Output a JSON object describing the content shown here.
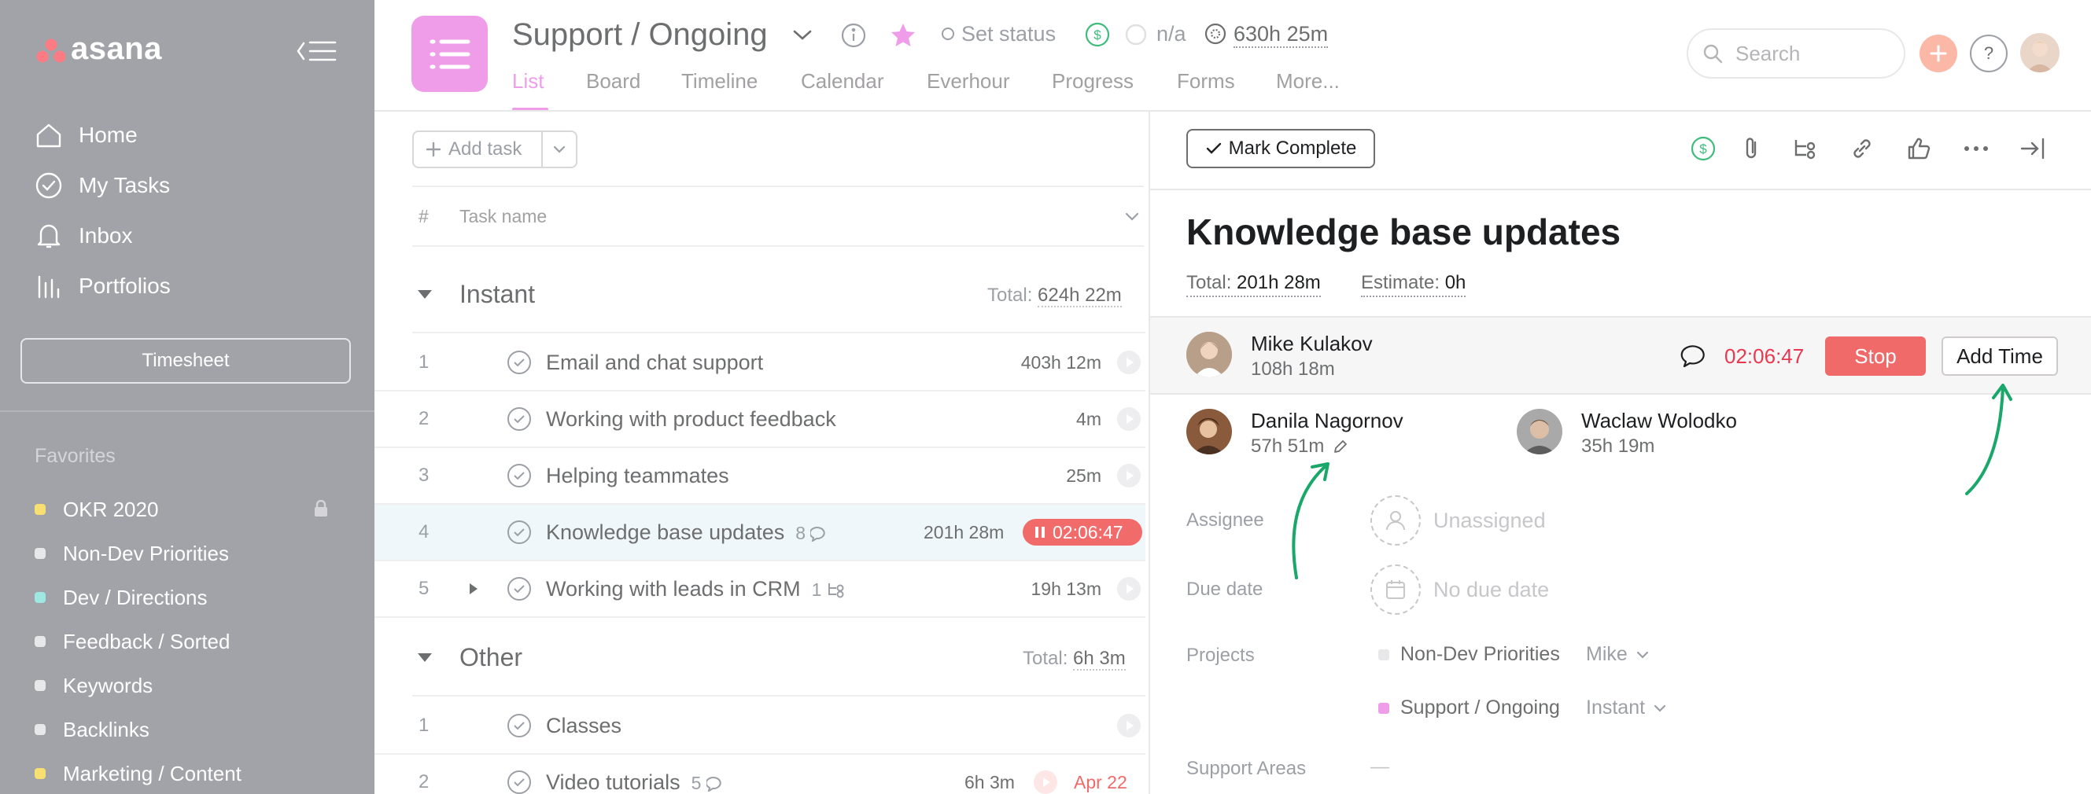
{
  "sidebar": {
    "logo": "asana",
    "nav": [
      {
        "label": "Home",
        "icon": "home-icon"
      },
      {
        "label": "My Tasks",
        "icon": "check-circle-icon"
      },
      {
        "label": "Inbox",
        "icon": "bell-icon"
      },
      {
        "label": "Portfolios",
        "icon": "bar-chart-icon"
      }
    ],
    "timesheet_label": "Timesheet",
    "favorites_heading": "Favorites",
    "favorites": [
      {
        "label": "OKR 2020",
        "color": "#f8df72"
      },
      {
        "label": "Non-Dev Priorities",
        "color": "#e8e8ea"
      },
      {
        "label": "Dev / Directions",
        "color": "#9ee7e3"
      },
      {
        "label": "Feedback / Sorted",
        "color": "#e8e8ea"
      },
      {
        "label": "Keywords",
        "color": "#e8e8ea"
      },
      {
        "label": "Backlinks",
        "color": "#e8e8ea"
      },
      {
        "label": "Marketing / Content",
        "color": "#f8df72"
      }
    ],
    "background": "#a2a2a9"
  },
  "header": {
    "project_title": "Support / Ongoing",
    "set_status": "Set status",
    "budget_na": "n/a",
    "time_total": "630h 25m",
    "tabs": [
      "List",
      "Board",
      "Timeline",
      "Calendar",
      "Everhour",
      "Progress",
      "Forms",
      "More..."
    ],
    "active_tab": "List",
    "search_placeholder": "Search",
    "accent": "#ef9de9"
  },
  "list": {
    "add_task_label": "Add task",
    "col_hash": "#",
    "col_task_name": "Task name",
    "sections": [
      {
        "title": "Instant",
        "total_label": "Total:",
        "total_value": "624h 22m",
        "tasks": [
          {
            "num": "1",
            "name": "Email and chat support",
            "meta": "",
            "time": "403h 12m"
          },
          {
            "num": "2",
            "name": "Working with product feedback",
            "meta": "",
            "time": "4m"
          },
          {
            "num": "3",
            "name": "Helping teammates",
            "meta": "",
            "time": "25m"
          },
          {
            "num": "4",
            "name": "Knowledge base updates",
            "meta": "8",
            "time": "201h 28m",
            "timer": "02:06:47"
          },
          {
            "num": "5",
            "name": "Working with leads in CRM",
            "meta": "1",
            "time": "19h 13m"
          }
        ]
      },
      {
        "title": "Other",
        "total_label": "Total:",
        "total_value": "6h 3m",
        "tasks": [
          {
            "num": "1",
            "name": "Classes",
            "meta": "",
            "time": ""
          },
          {
            "num": "2",
            "name": "Video tutorials",
            "meta": "5",
            "time": "6h 3m",
            "due": "Apr 22"
          }
        ]
      }
    ]
  },
  "detail": {
    "mark_complete": "Mark Complete",
    "title": "Knowledge base updates",
    "total_label": "Total:",
    "total_value": "201h 28m",
    "estimate_label": "Estimate:",
    "estimate_value": "0h",
    "tracker": {
      "name": "Mike Kulakov",
      "time": "108h 18m",
      "timer": "02:06:47",
      "stop_label": "Stop",
      "add_time_label": "Add Time"
    },
    "people": [
      {
        "name": "Danila Nagornov",
        "time": "57h 51m"
      },
      {
        "name": "Waclaw Wolodko",
        "time": "35h 19m"
      }
    ],
    "fields": {
      "assignee_label": "Assignee",
      "assignee_value": "Unassigned",
      "due_label": "Due date",
      "due_value": "No due date",
      "projects_label": "Projects",
      "support_label": "Support Areas",
      "support_value": "—"
    },
    "projects": [
      {
        "name": "Non-Dev Priorities",
        "section": "Mike",
        "color": "#e8e8ea"
      },
      {
        "name": "Support / Ongoing",
        "section": "Instant",
        "color": "#ef9de9"
      }
    ]
  }
}
